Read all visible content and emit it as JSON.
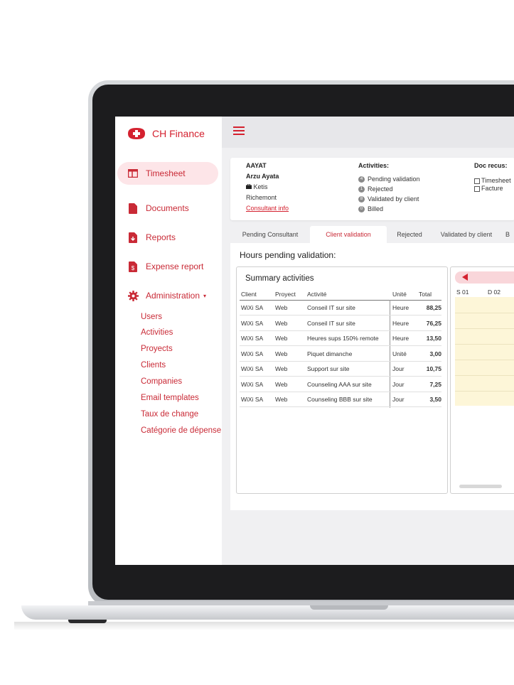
{
  "brand": {
    "title": "CH Finance",
    "accent": "#d4212f"
  },
  "nav": {
    "items": [
      {
        "label": "Timesheet",
        "icon": "table-icon",
        "active": true
      },
      {
        "label": "Documents",
        "icon": "document-icon"
      },
      {
        "label": "Reports",
        "icon": "report-icon"
      },
      {
        "label": "Expense report",
        "icon": "receipt-icon"
      },
      {
        "label": "Administration",
        "icon": "gear-icon",
        "caret": "▾"
      }
    ],
    "admin_items": [
      "Users",
      "Activities",
      "Proyects",
      "Clients",
      "Companies",
      "Email templates",
      "Taux de change",
      "Catégorie de dépense"
    ]
  },
  "consultant": {
    "code": "AAYAT",
    "name": "Arzu Ayata",
    "company": "Ketis",
    "location": "Richemont",
    "info_link": "Consultant info"
  },
  "activities": {
    "title": "Activities:",
    "items": [
      {
        "count": "4",
        "label": "Pending validation"
      },
      {
        "count": "1",
        "label": "Rejected"
      },
      {
        "count": "8",
        "label": "Validated by client"
      },
      {
        "count": "0",
        "label": "Billed"
      }
    ]
  },
  "docs": {
    "title": "Doc recus:",
    "items": [
      "Timesheet",
      "Facture"
    ]
  },
  "tabs": [
    "Pending Consultant",
    "Client validation",
    "Rejected",
    "Validated by client",
    "B"
  ],
  "active_tab": "Client validation",
  "panel": {
    "title": "Hours pending validation:"
  },
  "summary": {
    "title": "Summary activities",
    "columns": [
      "Client",
      "Proyect",
      "Activité",
      "Unité",
      "Total"
    ],
    "rows": [
      [
        "WiXi SA",
        "Web",
        "Conseil IT sur site",
        "Heure",
        "88,25"
      ],
      [
        "WiXi SA",
        "Web",
        "Conseil IT sur site",
        "Heure",
        "76,25"
      ],
      [
        "WiXi SA",
        "Web",
        "Heures sups 150% remote",
        "Heure",
        "13,50"
      ],
      [
        "WiXi SA",
        "Web",
        "Piquet dimanche",
        "Unité",
        "3,00"
      ],
      [
        "WiXi SA",
        "Web",
        "Support sur site",
        "Jour",
        "10,75"
      ],
      [
        "WiXi SA",
        "Web",
        "Counseling AAA sur site",
        "Jour",
        "7,25"
      ],
      [
        "WiXi SA",
        "Web",
        "Counseling BBB sur site",
        "Jour",
        "3,50"
      ]
    ]
  },
  "calendar": {
    "days": [
      "S 01",
      "D 02"
    ]
  }
}
